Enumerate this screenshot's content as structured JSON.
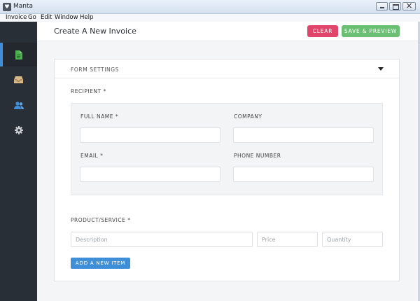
{
  "window": {
    "title": "Manta",
    "icon": "heart-icon"
  },
  "menu": [
    "Invoice",
    "Go",
    "Edit",
    "Window",
    "Help"
  ],
  "sidebar": {
    "items": [
      {
        "name": "invoice-form",
        "icon": "document-icon",
        "color": "#4caf50",
        "active": true
      },
      {
        "name": "invoices-archive",
        "icon": "inbox-icon",
        "color": "#d9b98a"
      },
      {
        "name": "contacts",
        "icon": "users-icon",
        "color": "#3f8fd8"
      },
      {
        "name": "settings",
        "icon": "gear-icon",
        "color": "#cfd3d7"
      }
    ]
  },
  "header": {
    "title": "Create A New Invoice",
    "clear_label": "CLEAR",
    "save_label": "SAVE & PREVIEW"
  },
  "form": {
    "settings_label": "FORM SETTINGS",
    "recipient_label": "RECIPIENT *",
    "full_name_label": "FULL NAME *",
    "company_label": "COMPANY",
    "email_label": "EMAIL *",
    "phone_label": "PHONE NUMBER",
    "full_name_value": "",
    "company_value": "",
    "email_value": "",
    "phone_value": "",
    "product_label": "PRODUCT/SERVICE *",
    "description_placeholder": "Description",
    "price_placeholder": "Price",
    "quantity_placeholder": "Quantity",
    "add_item_label": "ADD A NEW ITEM"
  },
  "colors": {
    "accent": "#3f8fd8",
    "danger": "#e2456b",
    "success": "#6bbf73",
    "sidebar_bg": "#292f36"
  }
}
